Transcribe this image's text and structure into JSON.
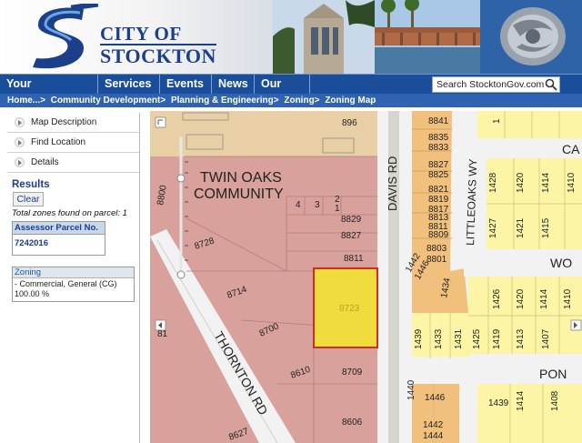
{
  "header": {
    "logo_line1": "CITY OF",
    "logo_line2": "STOCKTON"
  },
  "nav": {
    "items": [
      {
        "label": "Your Government"
      },
      {
        "label": "Services"
      },
      {
        "label": "Events"
      },
      {
        "label": "News"
      },
      {
        "label": "Our City"
      }
    ],
    "search_placeholder": "Search StocktonGov.com"
  },
  "breadcrumb": [
    "Home...>",
    "Community Development>",
    "Planning & Engineering>",
    "Zoning>",
    "Zoning Map"
  ],
  "sidebar": {
    "sections": [
      {
        "label": "Map Description"
      },
      {
        "label": "Find Location"
      },
      {
        "label": "Details"
      }
    ],
    "results_title": "Results",
    "clear_label": "Clear",
    "total_zones": "Total zones found on parcel: 1",
    "apn_header": "Assessor Parcel No.",
    "apn_value": "7242016",
    "zoning_header": "Zoning",
    "zoning_line1": "- Commercial, General (CG)",
    "zoning_line2": "100.00 %"
  },
  "map": {
    "community_label_1": "TWIN OAKS",
    "community_label_2": "COMMUNITY",
    "road_davis": "DAVIS RD",
    "road_thornton": "THORNTON RD",
    "road_littleoaks": "LITTLEOAKS WY",
    "street_ca": "CA",
    "street_wo": "WO",
    "street_pon": "PON",
    "selected_parcel": "8723",
    "parcels_left": [
      "896",
      "8829",
      "8827",
      "8811",
      "8728",
      "8714",
      "8700",
      "8610",
      "8709",
      "8606",
      "8627",
      "8800",
      "81",
      "4",
      "3",
      "2",
      "1"
    ],
    "parcels_right": [
      "8841",
      "8835",
      "8833",
      "8827",
      "8825",
      "8821",
      "8819",
      "8817",
      "8813",
      "8811",
      "8809",
      "8803",
      "8801"
    ],
    "colors": {
      "commercial": "#d9a19c",
      "residential": "#fbf5a5",
      "multi_family": "#f2c07d",
      "selected": "#f0dc3c",
      "selected_border": "#d42b1e",
      "road": "#f2f2f2",
      "nav_blue": "#1a4e9b"
    }
  }
}
